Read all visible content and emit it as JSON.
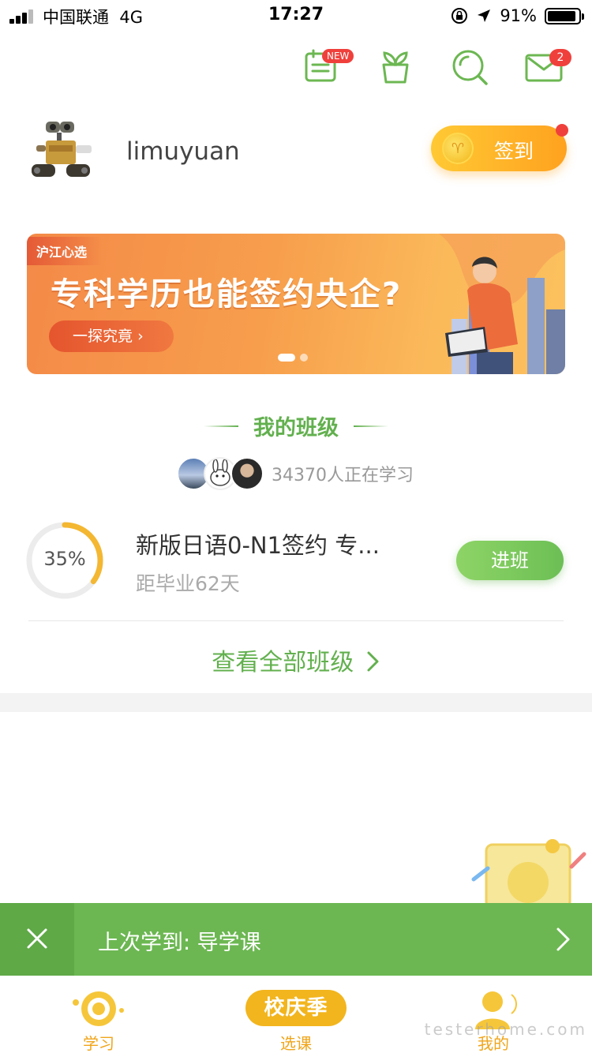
{
  "status_bar": {
    "carrier": "中国联通",
    "network": "4G",
    "time": "17:27",
    "battery": "91%",
    "battery_level": 0.91
  },
  "top_icons": [
    {
      "name": "calendar-icon",
      "badge": "NEW"
    },
    {
      "name": "plant-icon"
    },
    {
      "name": "search-icon"
    },
    {
      "name": "mail-icon",
      "badge": "2"
    }
  ],
  "profile": {
    "username": "limuyuan",
    "signin_label": "签到"
  },
  "banner": {
    "tag": "沪江心选",
    "title": "专科学历也能签约央企?",
    "button": "一探究竟",
    "page_count": 2,
    "active_page": 0
  },
  "my_class": {
    "title": "我的班级",
    "learners_text": "34370人正在学习",
    "course": {
      "progress": 35,
      "progress_label": "35%",
      "name": "新版日语0-N1签约 专...",
      "countdown": "距毕业62天",
      "button": "进班"
    },
    "view_all": "查看全部班级"
  },
  "last_studied": {
    "text": "上次学到: 导学课"
  },
  "tabs": [
    {
      "label": "学习",
      "icon": "study-icon"
    },
    {
      "label": "选课",
      "promo": "校庆季"
    },
    {
      "label": "我的",
      "icon": "profile-icon"
    }
  ],
  "colors": {
    "brand_green": "#62b04e",
    "accent_orange": "#f0a51a",
    "badge_red": "#f0403c"
  },
  "watermark": "testerhome.com"
}
